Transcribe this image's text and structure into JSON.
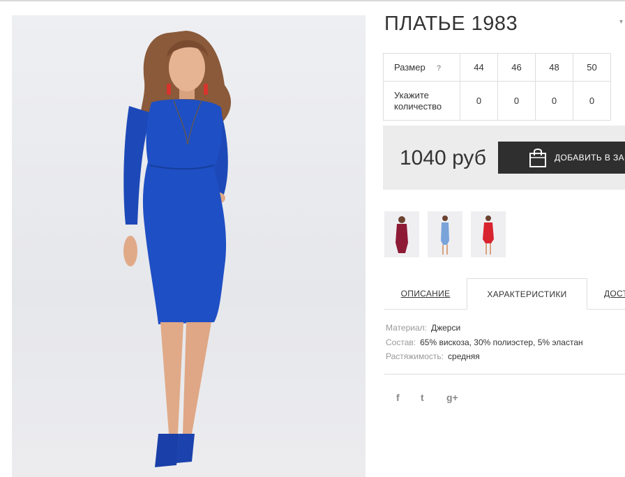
{
  "product": {
    "title": "ПЛАТЬЕ 1983",
    "dress_color": "#1e4fc4"
  },
  "size_table": {
    "size_label": "Размер",
    "help_mark": "?",
    "sizes": [
      "44",
      "46",
      "48",
      "50"
    ],
    "qty_label_line1": "Укажите",
    "qty_label_line2": "количество",
    "quantities": [
      "0",
      "0",
      "0",
      "0"
    ]
  },
  "purchase": {
    "price": "1040 руб",
    "button_label": "ДОБАВИТЬ В ЗАКАЗ"
  },
  "color_variants": [
    {
      "color": "#8e1b36"
    },
    {
      "color": "#7aa3da"
    },
    {
      "color": "#d8242f"
    }
  ],
  "tabs": [
    {
      "label": "ОПИСАНИЕ"
    },
    {
      "label": "ХАРАКТЕРИСТИКИ"
    },
    {
      "label": "ДОСТАВКА"
    }
  ],
  "specs": [
    {
      "key": "Материал:",
      "value": "Джерси"
    },
    {
      "key": "Состав:",
      "value": "65% вискоза, 30% полиэстер, 5% эластан"
    },
    {
      "key": "Растяжимость:",
      "value": "средняя"
    }
  ],
  "social": {
    "facebook": "f",
    "twitter": "t",
    "gplus": "g+"
  }
}
